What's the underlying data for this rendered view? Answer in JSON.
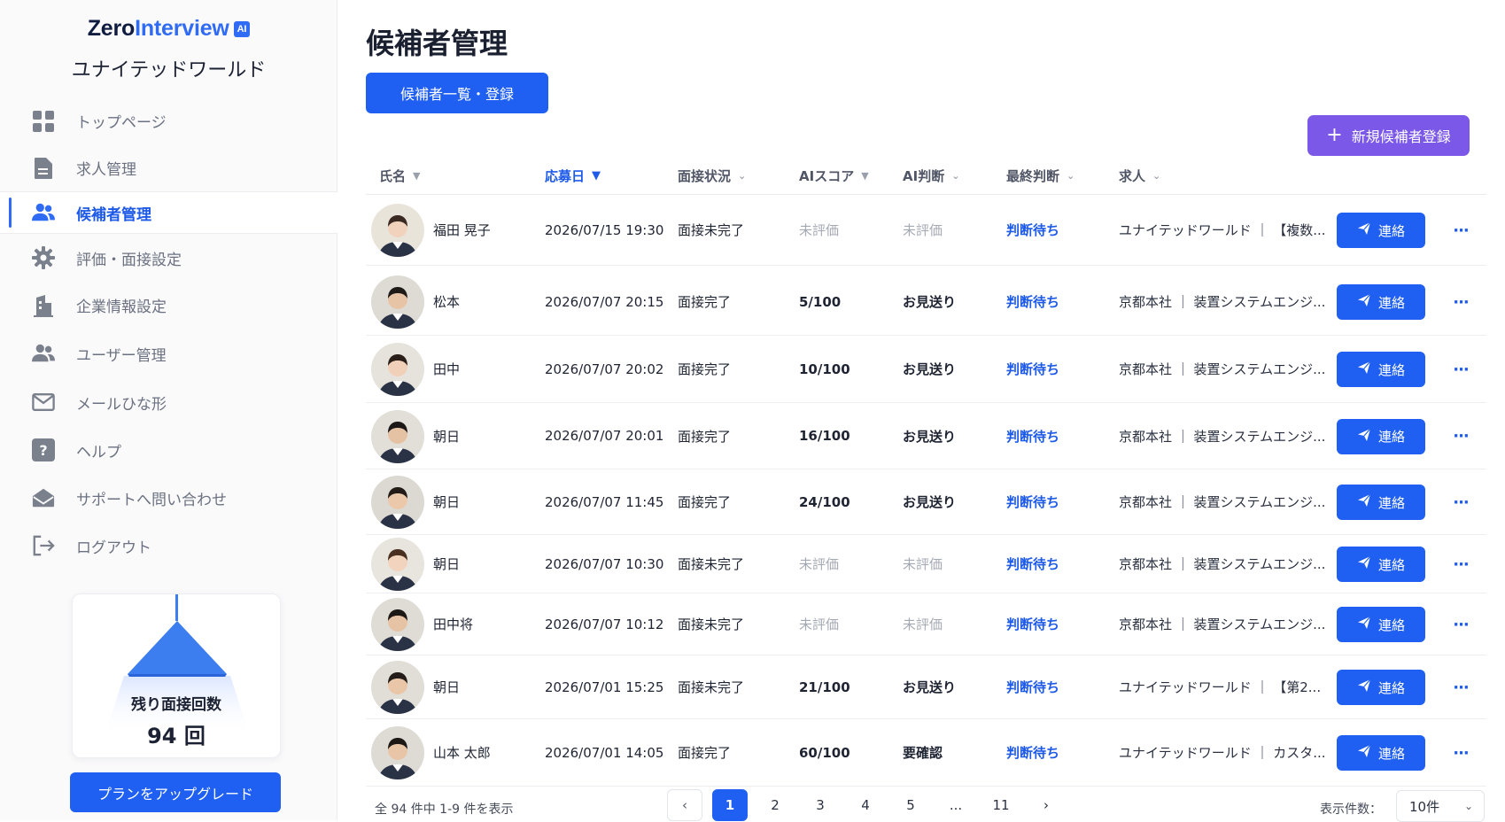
{
  "brand": {
    "logo_main": "Zero",
    "logo_accent": "Interview",
    "logo_badge": "AI",
    "company": "ユナイテッドワールド"
  },
  "sidebar": {
    "items": [
      {
        "label": "トップページ",
        "icon": "grid-icon",
        "active": false
      },
      {
        "label": "求人管理",
        "icon": "document-icon",
        "active": false
      },
      {
        "label": "候補者管理",
        "icon": "users-icon",
        "active": true
      },
      {
        "label": "評価・面接設定",
        "icon": "gear-icon",
        "active": false
      },
      {
        "label": "企業情報設定",
        "icon": "building-icon",
        "active": false
      },
      {
        "label": "ユーザー管理",
        "icon": "users-icon",
        "active": false
      },
      {
        "label": "メールひな形",
        "icon": "mail-icon",
        "active": false
      },
      {
        "label": "ヘルプ",
        "icon": "help-icon",
        "active": false
      },
      {
        "label": "サポートへ問い合わせ",
        "icon": "envelope-open-icon",
        "active": false
      },
      {
        "label": "ログアウト",
        "icon": "logout-icon",
        "active": false
      }
    ],
    "quota": {
      "label": "残り面接回数",
      "value": "94 回"
    },
    "upgrade_label": "プランをアップグレード"
  },
  "main": {
    "title": "候補者管理",
    "tab_label": "候補者一覧・登録",
    "new_button_label": "新規候補者登録",
    "columns": {
      "name": "氏名",
      "date": "応募日",
      "status": "面接状況",
      "score": "AIスコア",
      "ai": "AI判断",
      "final": "最終判断",
      "job": "求人"
    },
    "contact_label": "連絡",
    "more_label": "···",
    "rows": [
      {
        "name": "福田 晃子",
        "date": "2026/07/15 19:30",
        "status": "面接未完了",
        "score": "未評価",
        "ai": "未評価",
        "final": "判断待ち",
        "job": "ユナイテッドワールド ｜ 【複数..."
      },
      {
        "name": "松本",
        "date": "2026/07/07 20:15",
        "status": "面接完了",
        "score": "5/100",
        "ai": "お見送り",
        "final": "判断待ち",
        "job": "京都本社 ｜ 装置システムエンジ..."
      },
      {
        "name": "田中",
        "date": "2026/07/07 20:02",
        "status": "面接完了",
        "score": "10/100",
        "ai": "お見送り",
        "final": "判断待ち",
        "job": "京都本社 ｜ 装置システムエンジ..."
      },
      {
        "name": "朝日",
        "date": "2026/07/07 20:01",
        "status": "面接完了",
        "score": "16/100",
        "ai": "お見送り",
        "final": "判断待ち",
        "job": "京都本社 ｜ 装置システムエンジ..."
      },
      {
        "name": "朝日",
        "date": "2026/07/07 11:45",
        "status": "面接完了",
        "score": "24/100",
        "ai": "お見送り",
        "final": "判断待ち",
        "job": "京都本社 ｜ 装置システムエンジ..."
      },
      {
        "name": "朝日",
        "date": "2026/07/07 10:30",
        "status": "面接未完了",
        "score": "未評価",
        "ai": "未評価",
        "final": "判断待ち",
        "job": "京都本社 ｜ 装置システムエンジ..."
      },
      {
        "name": "田中将",
        "date": "2026/07/07 10:12",
        "status": "面接未完了",
        "score": "未評価",
        "ai": "未評価",
        "final": "判断待ち",
        "job": "京都本社 ｜ 装置システムエンジ..."
      },
      {
        "name": "朝日",
        "date": "2026/07/01 15:25",
        "status": "面接未完了",
        "score": "21/100",
        "ai": "お見送り",
        "final": "判断待ち",
        "job": "ユナイテッドワールド ｜ 【第2..."
      },
      {
        "name": "山本 太郎",
        "date": "2026/07/01 14:05",
        "status": "面接完了",
        "score": "60/100",
        "ai": "要確認",
        "final": "判断待ち",
        "job": "ユナイテッドワールド ｜ カスタ..."
      }
    ],
    "pagination": {
      "summary": "全 94 件中 1-9 件を表示",
      "prev": "‹",
      "next": "›",
      "pages": [
        "1",
        "2",
        "3",
        "4",
        "5",
        "...",
        "11"
      ],
      "current": "1",
      "per_page_label": "表示件数：",
      "per_page_value": "10件"
    }
  },
  "colors": {
    "primary": "#1f5ff2",
    "accent": "#7b58e8",
    "link": "#1e5ae8"
  }
}
